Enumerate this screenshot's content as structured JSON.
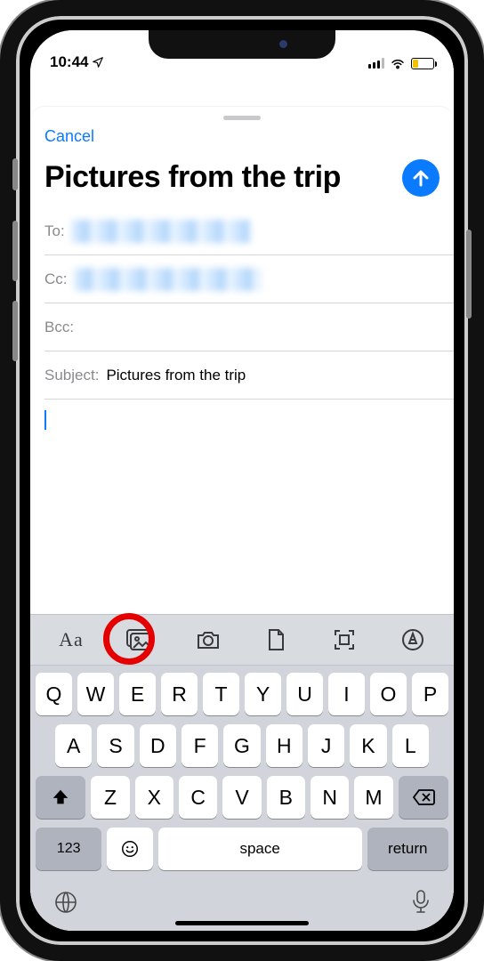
{
  "status": {
    "time": "10:44",
    "loc_icon": "location-arrow"
  },
  "nav": {
    "cancel": "Cancel"
  },
  "compose": {
    "title": "Pictures from the trip",
    "to_label": "To:",
    "cc_label": "Cc:",
    "bcc_label": "Bcc:",
    "subject_label": "Subject:",
    "subject_value": "Pictures from the trip"
  },
  "toolbar": {
    "format": "Aa"
  },
  "keyboard": {
    "row1": [
      "Q",
      "W",
      "E",
      "R",
      "T",
      "Y",
      "U",
      "I",
      "O",
      "P"
    ],
    "row2": [
      "A",
      "S",
      "D",
      "F",
      "G",
      "H",
      "J",
      "K",
      "L"
    ],
    "row3": [
      "Z",
      "X",
      "C",
      "V",
      "B",
      "N",
      "M"
    ],
    "num_key": "123",
    "space": "space",
    "return": "return"
  }
}
